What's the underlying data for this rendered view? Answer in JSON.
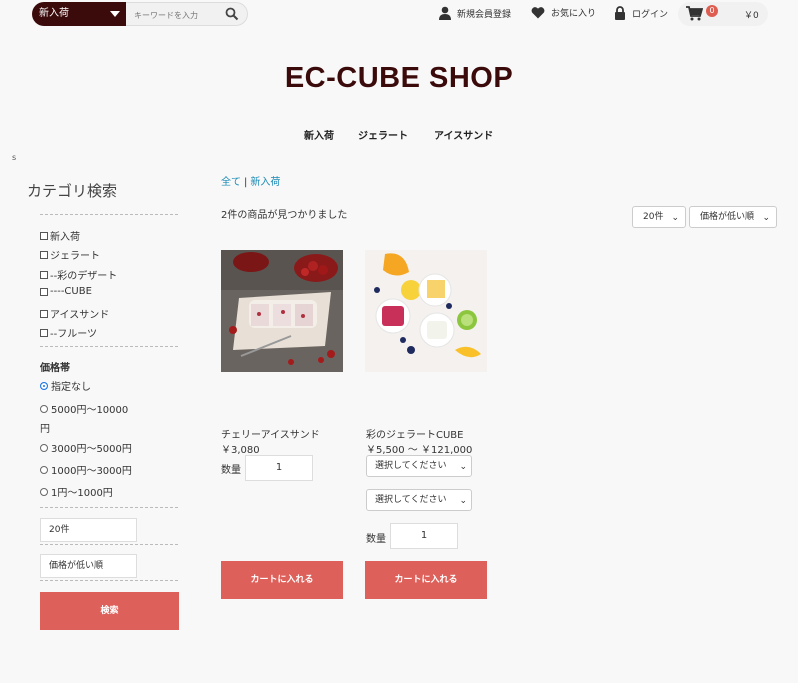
{
  "header": {
    "search_category": "新入荷",
    "search_placeholder": "キーワードを入力",
    "links": {
      "register": "新規会員登録",
      "favorites": "お気に入り",
      "login": "ログイン"
    },
    "cart_count": "0",
    "cart_total": "￥0"
  },
  "shop_title": "EC-CUBE SHOP",
  "nav": [
    "新入荷",
    "ジェラート",
    "アイスサンド"
  ],
  "stray_text": "s",
  "sidebar": {
    "title": "カテゴリ検索",
    "categories": [
      "新入荷",
      "ジェラート",
      "--彩のデザート",
      "----CUBE",
      "アイスサンド",
      "--フルーツ"
    ],
    "price_title": "価格帯",
    "price_options": [
      "指定なし",
      "5000円～10000",
      "円",
      "3000円～5000円",
      "1000円～3000円",
      "1円～1000円"
    ],
    "price_selected": 0,
    "count_select": "20件",
    "sort_select": "価格が低い順",
    "search_button": "検索"
  },
  "main": {
    "breadcrumb": [
      "全て",
      "新入荷"
    ],
    "result_count": "2件の商品が見つかりました",
    "count_select": "20件",
    "sort_select": "価格が低い順",
    "products": [
      {
        "name": "チェリーアイスサンド",
        "price": "￥3,080",
        "qty_label": "数量",
        "qty": "1",
        "cart_button": "カートに入れる"
      },
      {
        "name": "彩のジェラートCUBE",
        "price": "￥5,500 ～ ￥121,000",
        "option1": "選択してください",
        "option2": "選択してください",
        "qty_label": "数量",
        "qty": "1",
        "cart_button": "カートに入れる"
      }
    ]
  },
  "colors": {
    "brand_dark": "#3b0a0a",
    "button": "#de605a",
    "link": "#1a8ab5",
    "badge": "#de5d50"
  }
}
